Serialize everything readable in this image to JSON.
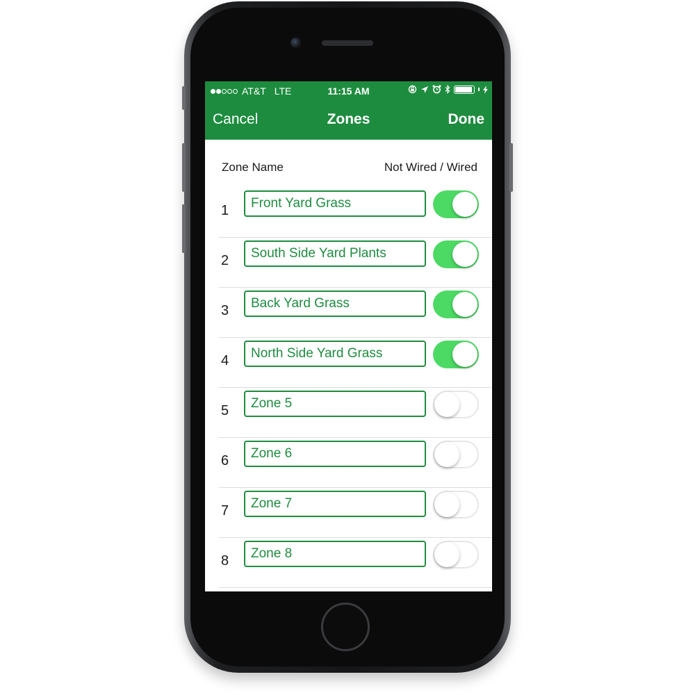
{
  "status_bar": {
    "carrier": "AT&T",
    "network": "LTE",
    "signal_bars_filled": 2,
    "signal_bars_total": 5,
    "time": "11:15 AM",
    "icons": [
      "orientation-lock-icon",
      "location-arrow-icon",
      "alarm-icon",
      "bluetooth-icon",
      "battery-icon",
      "charging-bolt-icon"
    ]
  },
  "nav": {
    "cancel_label": "Cancel",
    "title": "Zones",
    "done_label": "Done"
  },
  "header": {
    "zone_name_label": "Zone Name",
    "wired_label": "Not Wired / Wired"
  },
  "zones": [
    {
      "number": "1",
      "name": "Front Yard Grass",
      "wired": true
    },
    {
      "number": "2",
      "name": "South Side Yard Plants",
      "wired": true
    },
    {
      "number": "3",
      "name": "Back Yard Grass",
      "wired": true
    },
    {
      "number": "4",
      "name": "North Side Yard Grass",
      "wired": true
    },
    {
      "number": "5",
      "name": "Zone 5",
      "wired": false
    },
    {
      "number": "6",
      "name": "Zone 6",
      "wired": false
    },
    {
      "number": "7",
      "name": "Zone 7",
      "wired": false
    },
    {
      "number": "8",
      "name": "Zone 8",
      "wired": false
    }
  ],
  "colors": {
    "brand_green": "#1e8c3f",
    "toggle_on": "#4cd964"
  }
}
